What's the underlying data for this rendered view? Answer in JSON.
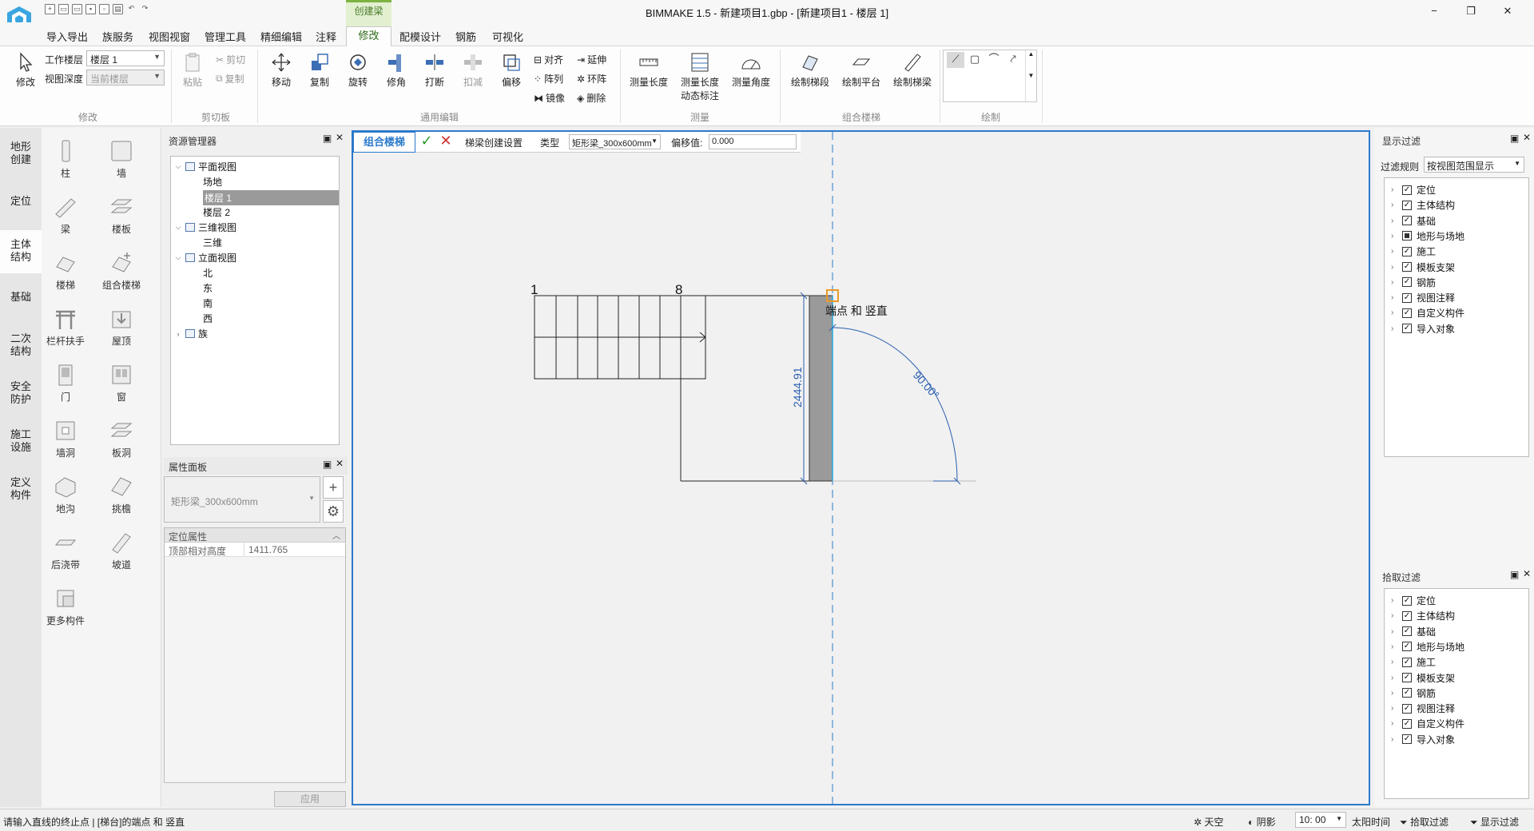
{
  "window": {
    "title": "BIMMAKE 1.5 - 新建项目1.gbp - [新建项目1 - 楼层 1]",
    "minimize": "−",
    "restore": "❐",
    "close": "✕"
  },
  "menu": {
    "tabs": [
      "导入导出",
      "族服务",
      "视图视窗",
      "管理工具",
      "精细编辑",
      "注释",
      "修改",
      "配模设计",
      "钢筋",
      "可视化"
    ],
    "context_tab": "创建梁",
    "active_tab": "修改",
    "help": "?",
    "doc_min": "−",
    "doc_restore": "❐",
    "doc_close": "✕"
  },
  "ribbon": {
    "modify": {
      "label": "修改",
      "group": "修改"
    },
    "work_floor_label": "工作楼层",
    "work_floor_value": "楼层 1",
    "view_depth_label": "视图深度",
    "view_depth_value": "当前楼层",
    "clipboard": {
      "paste": "粘贴",
      "cut": "剪切",
      "copy": "复制",
      "group": "剪切板"
    },
    "general_edit": {
      "move": "移动",
      "copy": "复制",
      "rotate": "旋转",
      "trim": "修角",
      "split": "打断",
      "deduct": "扣减",
      "offset": "偏移",
      "align": "对齐",
      "array": "阵列",
      "mirror": "镜像",
      "extend": "延伸",
      "ring": "环阵",
      "delete": "删除",
      "group": "通用编辑"
    },
    "measure": {
      "length": "测量长度",
      "length_dyn_1": "测量长度",
      "length_dyn_2": "动态标注",
      "angle": "测量角度",
      "group": "测量"
    },
    "stair": {
      "draw_flight": "绘制梯段",
      "draw_platform": "绘制平台",
      "draw_beam": "绘制梯梁",
      "group": "组合楼梯"
    },
    "draw": {
      "group": "绘制"
    }
  },
  "left_tabs": [
    "地形创建",
    "定位",
    "主体结构",
    "基础",
    "二次结构",
    "安全防护",
    "施工设施",
    "定义构件"
  ],
  "components": [
    "柱",
    "墙",
    "梁",
    "楼板",
    "楼梯",
    "组合楼梯",
    "栏杆扶手",
    "屋顶",
    "门",
    "窗",
    "墙洞",
    "板洞",
    "地沟",
    "挑檐",
    "后浇带",
    "坡道",
    "更多构件"
  ],
  "resource_manager": {
    "title": "资源管理器",
    "tree": [
      {
        "label": "平面视图",
        "level": 0,
        "expand": "v"
      },
      {
        "label": "场地",
        "level": 1
      },
      {
        "label": "楼层 1",
        "level": 1,
        "selected": true
      },
      {
        "label": "楼层 2",
        "level": 1
      },
      {
        "label": "三维视图",
        "level": 0,
        "expand": "v"
      },
      {
        "label": "三维",
        "level": 1
      },
      {
        "label": "立面视图",
        "level": 0,
        "expand": "v"
      },
      {
        "label": "北",
        "level": 1
      },
      {
        "label": "东",
        "level": 1
      },
      {
        "label": "南",
        "level": 1
      },
      {
        "label": "西",
        "level": 1
      },
      {
        "label": "族",
        "level": 0,
        "expand": ">"
      }
    ]
  },
  "properties": {
    "title": "属性面板",
    "type": "矩形梁_300x600mm",
    "section": "定位属性",
    "rows": [
      {
        "key": "顶部相对高度",
        "value": "1411.765"
      }
    ],
    "apply": "应用"
  },
  "options_bar": {
    "mode": "组合楼梯",
    "settings": "梯梁创建设置",
    "type_label": "类型",
    "type_value": "矩形梁_300x600mm",
    "offset_label": "偏移值:",
    "offset_value": "0.000"
  },
  "canvas": {
    "stair_start": "1",
    "stair_end": "8",
    "snap_hint": "端点 和 竖直",
    "dimension": "2444.91",
    "angle": "90.00°"
  },
  "display_filter": {
    "title": "显示过滤",
    "rule_label": "过滤规则",
    "rule_value": "按视图范围显示",
    "items": [
      "定位",
      "主体结构",
      "基础",
      "地形与场地",
      "施工",
      "模板支架",
      "钢筋",
      "视图注释",
      "自定义构件",
      "导入对象"
    ]
  },
  "pick_filter": {
    "title": "拾取过滤",
    "items": [
      "定位",
      "主体结构",
      "基础",
      "地形与场地",
      "施工",
      "模板支架",
      "钢筋",
      "视图注释",
      "自定义构件",
      "导入对象"
    ]
  },
  "status": {
    "message": "请输入直线的终止点 | [梯台]的端点 和 竖直",
    "sky": "天空",
    "shadow": "阴影",
    "time": "10: 00",
    "sun_time": "太阳时间",
    "pick_filter": "拾取过滤",
    "display_filter": "显示过滤"
  },
  "colors": {
    "accent_blue": "#2a7acc",
    "context_green": "#7cb342",
    "snap_orange": "#e89a2a",
    "beam_gray": "#9a9a9a"
  }
}
